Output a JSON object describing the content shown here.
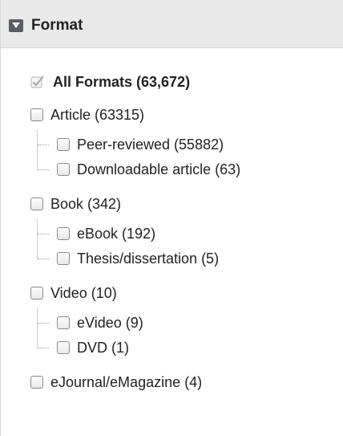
{
  "facet": {
    "title": "Format",
    "all": {
      "label": "All Formats (63,672)",
      "checked": true
    },
    "groups": [
      {
        "label": "Article (63315)",
        "children": [
          {
            "label": "Peer-reviewed (55882)"
          },
          {
            "label": "Downloadable article (63)"
          }
        ]
      },
      {
        "label": "Book (342)",
        "children": [
          {
            "label": "eBook (192)"
          },
          {
            "label": "Thesis/dissertation (5)"
          }
        ]
      },
      {
        "label": "Video (10)",
        "children": [
          {
            "label": "eVideo (9)"
          },
          {
            "label": "DVD (1)"
          }
        ]
      },
      {
        "label": "eJournal/eMagazine (4)",
        "children": []
      }
    ]
  },
  "icons": {
    "header_toggle": "collapse-triangle-icon",
    "checked": "checkmark-icon"
  },
  "colors": {
    "header_bg": "#e9e9e9",
    "toggle_bg": "#585d63",
    "text": "#222222",
    "check_disabled": "#a8a8a8"
  }
}
